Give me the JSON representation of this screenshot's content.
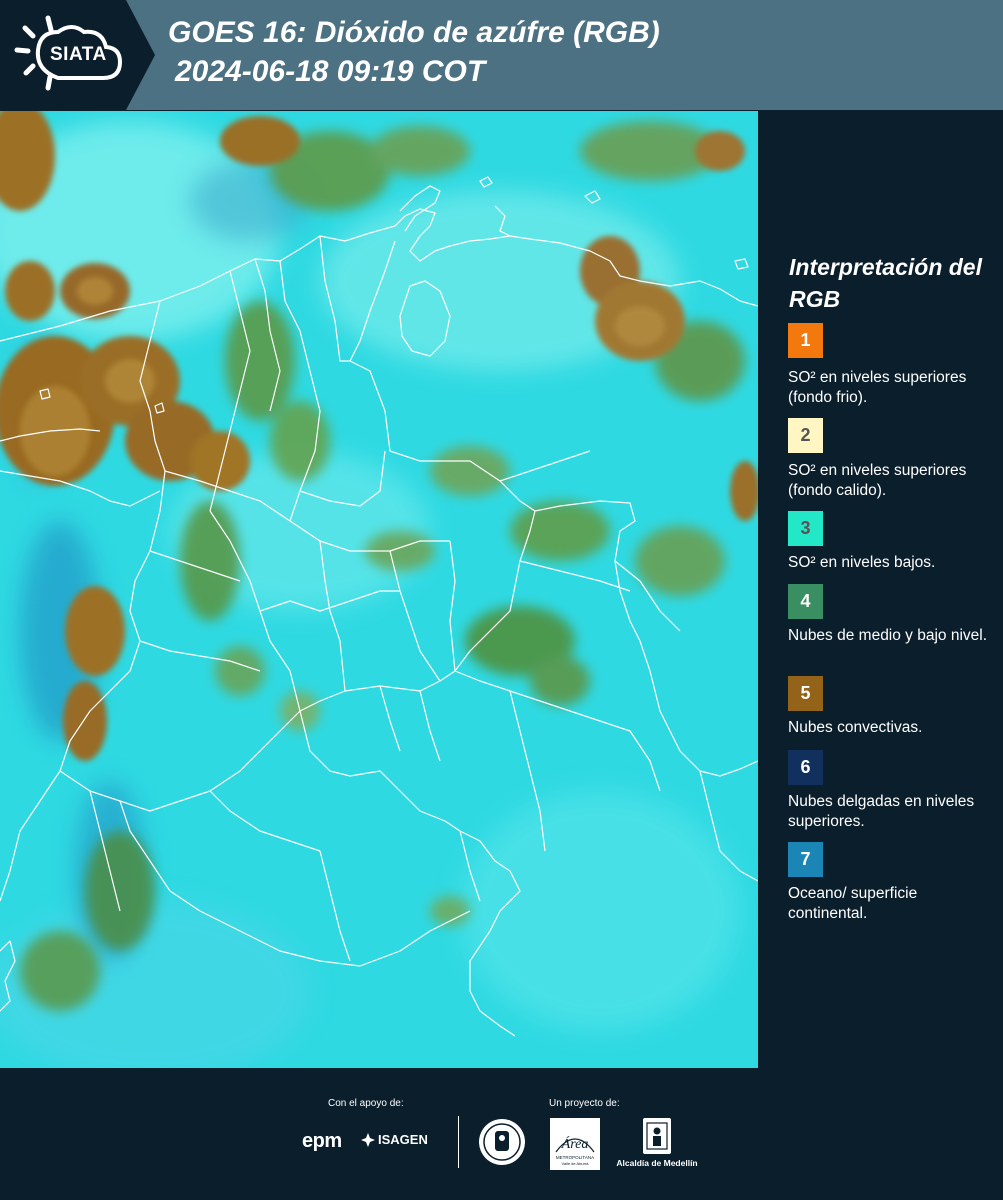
{
  "header": {
    "logo_text": "SIATA",
    "title_line_1": "GOES 16: Dióxido de azúfre (RGB)",
    "title_line_2": "2024-06-18 09:19 COT"
  },
  "map": {
    "background_color": "#2fd9e2",
    "border_color": "#ffffff"
  },
  "legend": {
    "title": "Interpretación del RGB",
    "items": [
      {
        "number": "1",
        "color": "#f3790f",
        "text_color": "#ffffff",
        "description": "SO² en niveles superiores (fondo frio)."
      },
      {
        "number": "2",
        "color": "#fff6c4",
        "text_color": "#555555",
        "description": "SO² en niveles superiores (fondo calido)."
      },
      {
        "number": "3",
        "color": "#22e8c8",
        "text_color": "#555555",
        "description": "SO² en niveles bajos."
      },
      {
        "number": "4",
        "color": "#3a8f62",
        "text_color": "#ffffff",
        "description": "Nubes de medio y bajo nivel."
      },
      {
        "number": "5",
        "color": "#94631a",
        "text_color": "#ffffff",
        "description": "Nubes convectivas."
      },
      {
        "number": "6",
        "color": "#12305e",
        "text_color": "#ffffff",
        "description": "Nubes delgadas en niveles superiores."
      },
      {
        "number": "7",
        "color": "#1b86b6",
        "text_color": "#ffffff",
        "description": "Oceano/ superficie continental."
      }
    ]
  },
  "footer": {
    "support_label": "Con el apoyo de:",
    "project_label": "Un proyecto de:",
    "epm_logo_text": "epm",
    "isagen_logo_text": "ISAGEN",
    "area_logo_text": "Área",
    "area_logo_subtext": "METROPOLITANA",
    "area_logo_subtext_2": "Valle de Aburrá",
    "alcaldia_text": "Alcaldía de Medellín"
  }
}
